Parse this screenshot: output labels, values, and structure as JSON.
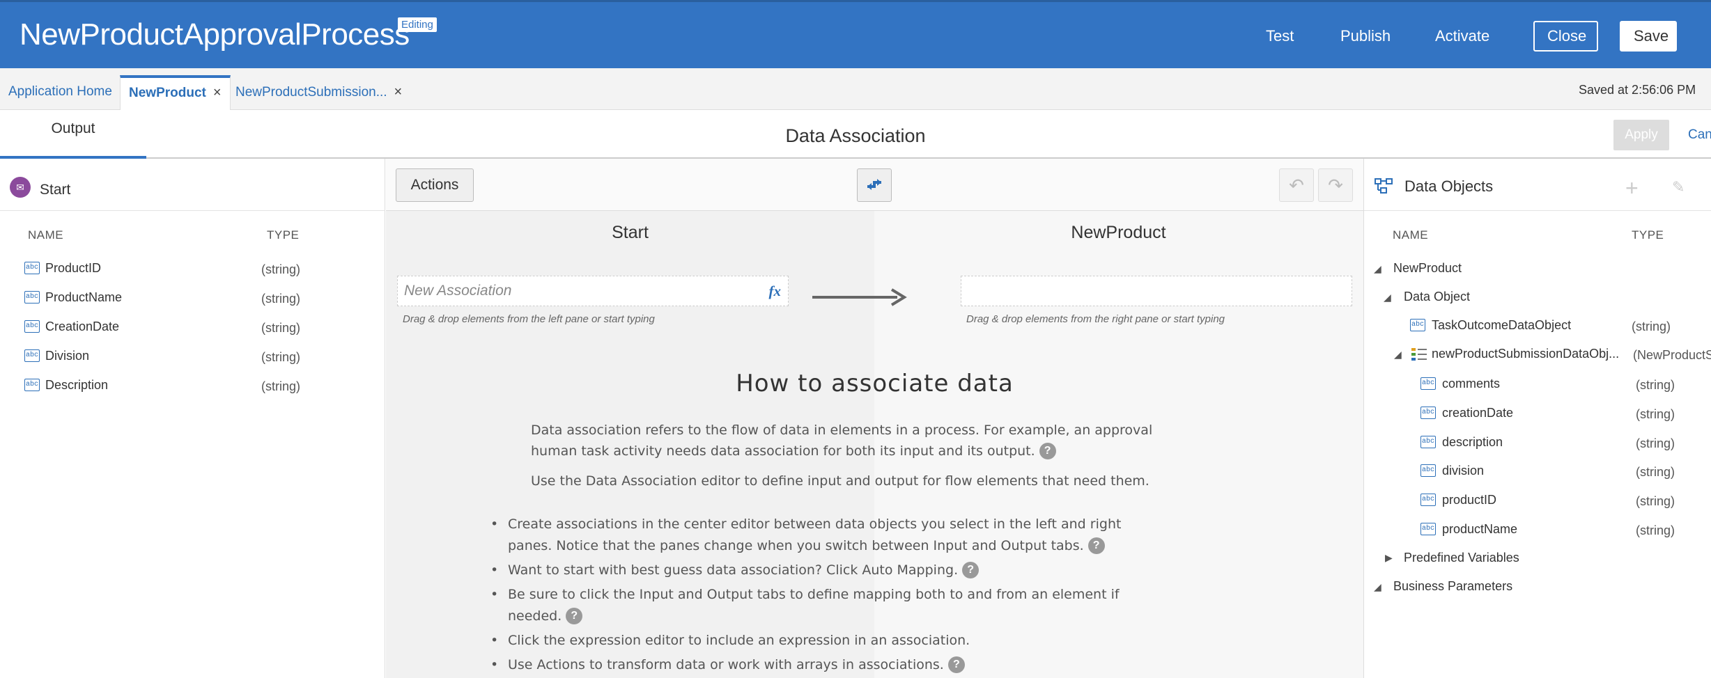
{
  "header": {
    "app_title": "NewProductApprovalProcess",
    "badge": "Editing",
    "links": [
      "Test",
      "Publish",
      "Activate"
    ],
    "close_label": "Close",
    "save_label": "Save",
    "bg_color": "#3374c3"
  },
  "tabs": {
    "items": [
      {
        "label": "Application Home"
      },
      {
        "label": "NewProduct",
        "close": "×"
      },
      {
        "label": "NewProductSubmission...",
        "close": "×"
      }
    ],
    "active_index": 1,
    "saved_at": "Saved at 2:56:06 PM"
  },
  "subheader": {
    "tab_label": "Output",
    "title": "Data Association",
    "apply_label": "Apply",
    "cancel_label": "Cancel"
  },
  "left_pane": {
    "title": "Start",
    "col_name": "NAME",
    "col_type": "TYPE",
    "rows": [
      {
        "name": "ProductID",
        "type": "(string)"
      },
      {
        "name": "ProductName",
        "type": "(string)"
      },
      {
        "name": "CreationDate",
        "type": "(string)"
      },
      {
        "name": "Division",
        "type": "(string)"
      },
      {
        "name": "Description",
        "type": "(string)"
      }
    ],
    "icon_text": "abc"
  },
  "center": {
    "actions_label": "Actions",
    "left_col_title": "Start",
    "right_col_title": "NewProduct",
    "assoc_placeholder": "New Association",
    "fx_label": "fx",
    "left_hint": "Drag & drop elements from the left pane or start typing",
    "right_hint": "Drag & drop elements from the right pane or start typing",
    "howto_title": "How to associate data",
    "para1": "Data association refers to the flow of data in elements in a process. For example, an approval human task activity needs data association for both its input and its output.",
    "para2": "Use the Data Association editor to define input and output for flow elements that need them.",
    "bullets": [
      "Create associations in the center editor between data objects you select in the left and right panes. Notice that the panes change when you switch between Input and Output tabs.",
      "Want to start with best guess data association? Click Auto Mapping.",
      "Be sure to click the Input and Output tabs to define mapping both to and from an element if needed.",
      "Click the expression editor to include an expression in an association.",
      "Use Actions to transform data or work with arrays in associations."
    ],
    "qmark": "?"
  },
  "right_pane": {
    "title": "Data Objects",
    "col_name": "NAME",
    "col_type": "TYPE",
    "tree": {
      "root": "NewProduct",
      "data_object": "Data Object",
      "task_outcome": {
        "name": "TaskOutcomeDataObject",
        "type": "(string)"
      },
      "submission": {
        "name": "newProductSubmissionDataObj...",
        "type": "(NewProductS"
      },
      "children": [
        {
          "name": "comments",
          "type": "(string)"
        },
        {
          "name": "creationDate",
          "type": "(string)"
        },
        {
          "name": "description",
          "type": "(string)"
        },
        {
          "name": "division",
          "type": "(string)"
        },
        {
          "name": "productID",
          "type": "(string)"
        },
        {
          "name": "productName",
          "type": "(string)"
        }
      ],
      "predefined": "Predefined Variables",
      "business": "Business Parameters"
    }
  }
}
